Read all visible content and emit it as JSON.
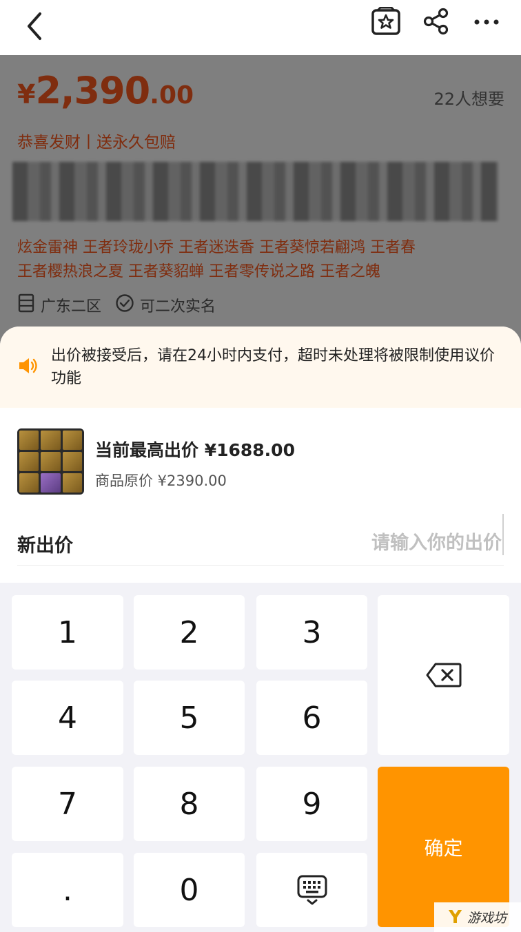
{
  "product": {
    "price_currency": "¥",
    "price_integer": "2,390",
    "price_decimal": ".00",
    "wanted_count": "22人想要",
    "slogan": "恭喜发财丨送永久包赔",
    "tags_line1": "炫金雷神 王者玲珑小乔 王者迷迭香 王者葵惊若翩鸿 王者春",
    "tags_line2": "王者樱热浪之夏 王者葵貂蝉 王者零传说之路 王者之魄",
    "region": "广东二区",
    "realname": "可二次实名"
  },
  "sheet": {
    "notice": "出价被接受后，请在24小时内支付，超时未处理将被限制使用议价功能",
    "highest_bid": "当前最高出价 ¥1688.00",
    "original_price": "商品原价 ¥2390.00",
    "new_bid_label": "新出价",
    "bid_placeholder": "请输入你的出价"
  },
  "keypad": {
    "k1": "1",
    "k2": "2",
    "k3": "3",
    "k4": "4",
    "k5": "5",
    "k6": "6",
    "k7": "7",
    "k8": "8",
    "k9": "9",
    "kdot": ".",
    "k0": "0",
    "confirm": "确定"
  },
  "watermark": {
    "logo": "Y",
    "text": "游戏坊"
  },
  "colors": {
    "accent_orange": "#ff9400",
    "price_red": "#ff5a1f",
    "notice_bg": "#fff8ee"
  }
}
